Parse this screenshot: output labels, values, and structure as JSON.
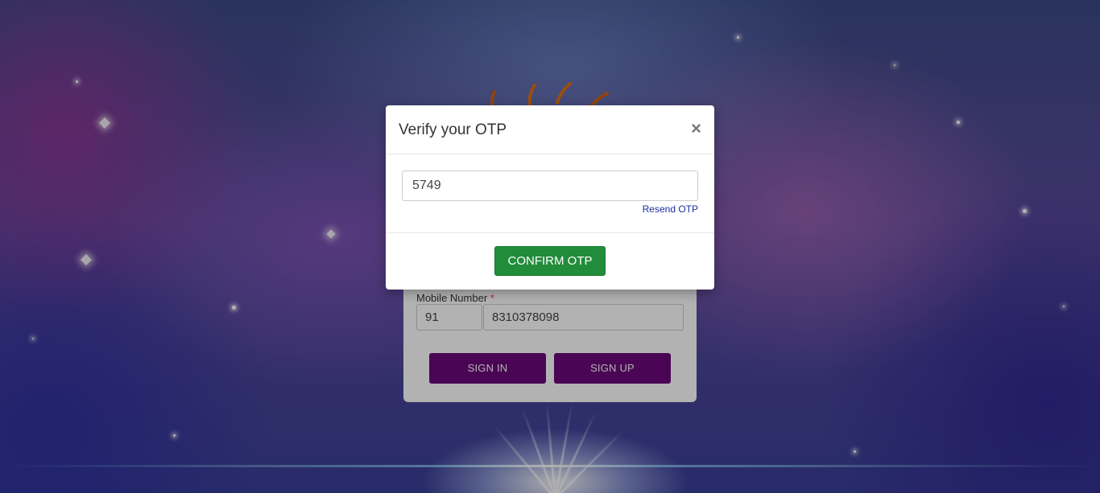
{
  "login": {
    "mobile_label": "Mobile Number",
    "required_marker": "*",
    "country_code": "91",
    "mobile_number": "8310378098",
    "signin_label": "SIGN IN",
    "signup_label": "SIGN UP"
  },
  "modal": {
    "title": "Verify your OTP",
    "close_symbol": "×",
    "otp_value": "5749",
    "resend_label": "Resend OTP",
    "confirm_label": "CONFIRM OTP",
    "confirm_color": "#218c3a"
  },
  "colors": {
    "primary_purple": "#6a0a7a",
    "link_blue": "#1a2ea0"
  },
  "icons": {
    "close": "close-icon",
    "logo": "sun-logo-icon"
  }
}
